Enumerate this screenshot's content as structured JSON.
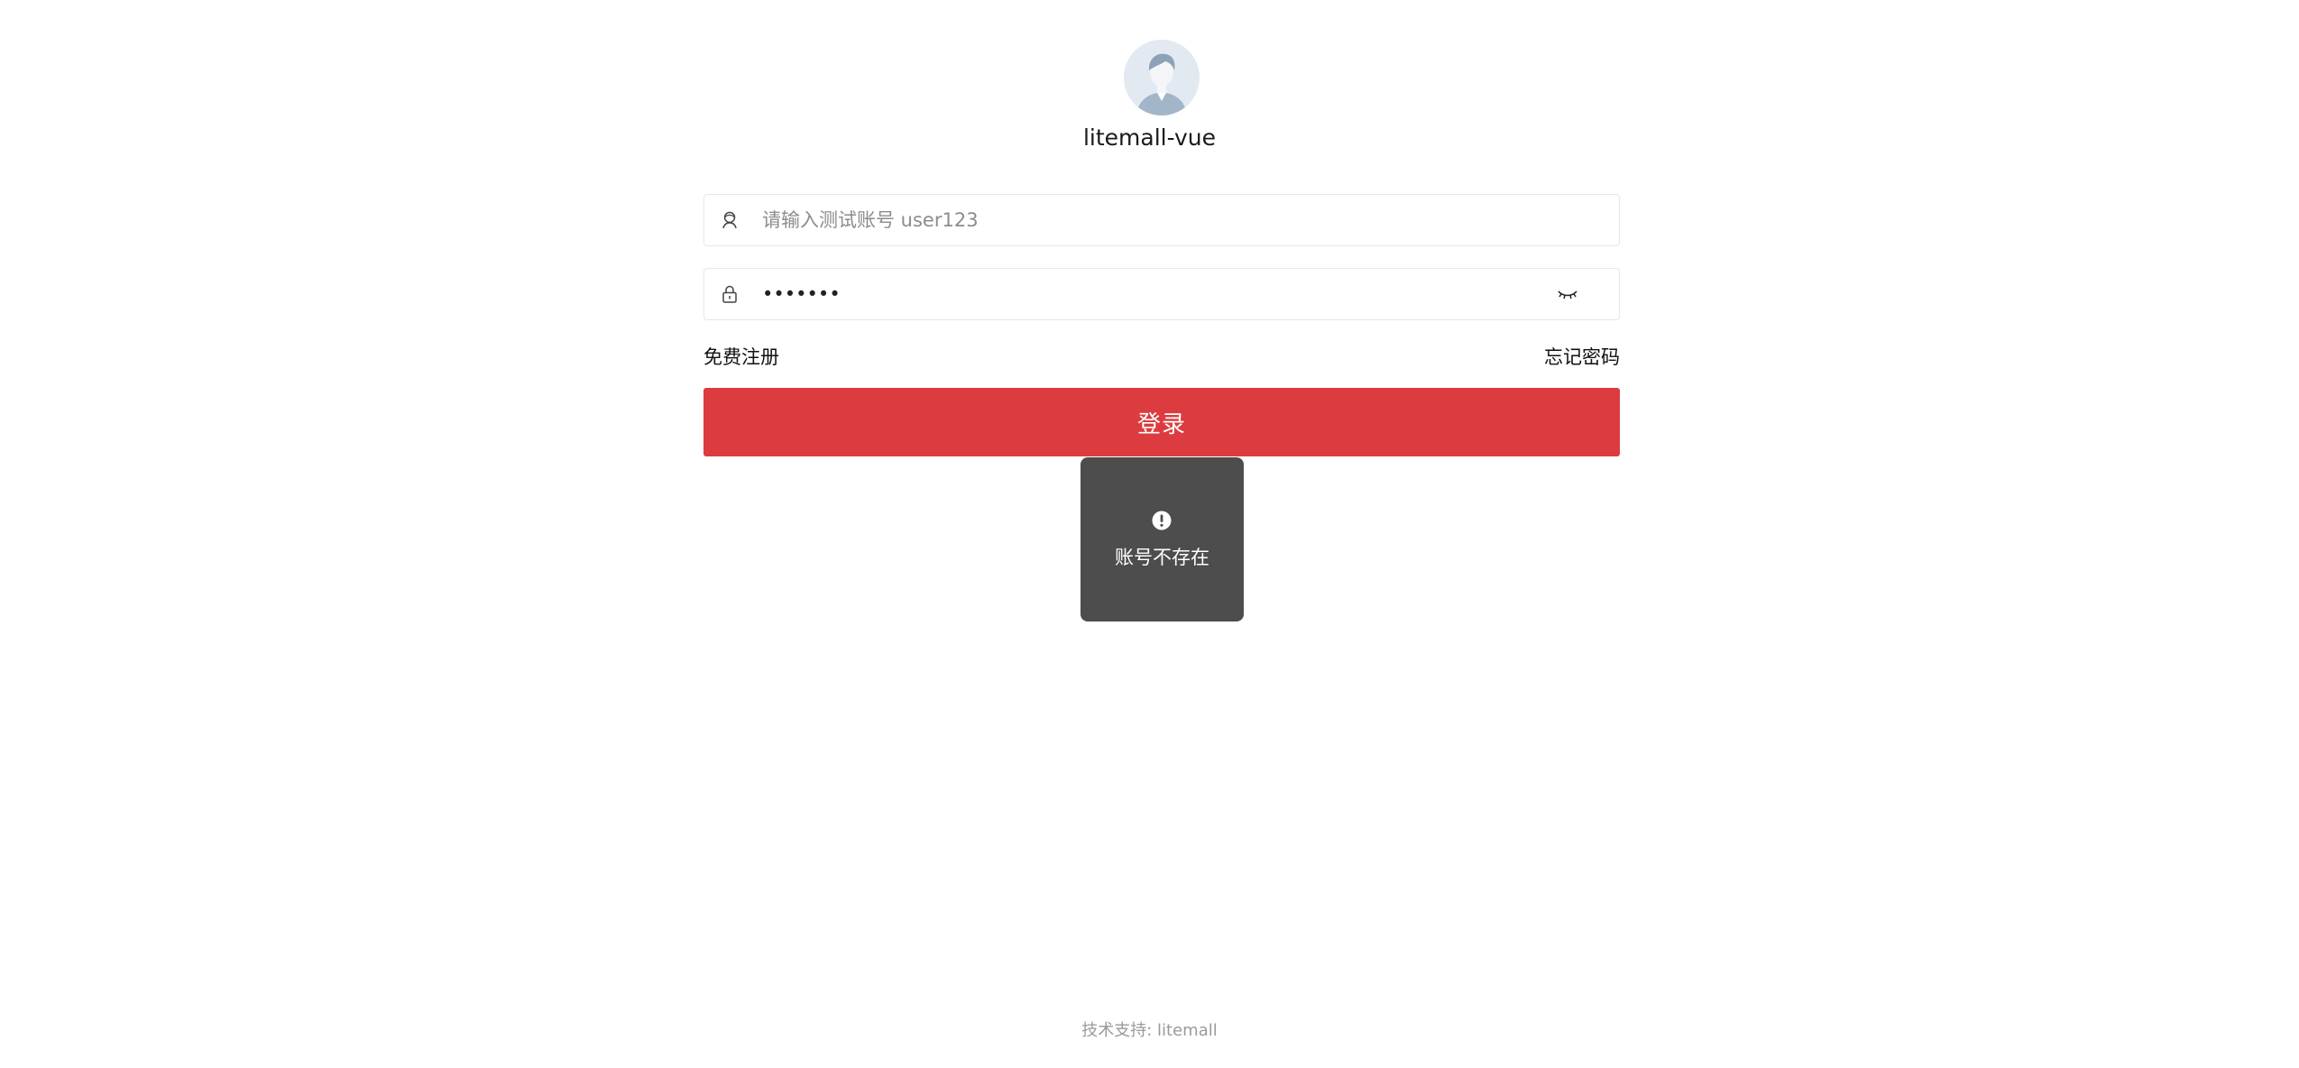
{
  "app": {
    "name": "litemall-vue"
  },
  "login_form": {
    "username": {
      "placeholder": "请输入测试账号 user123",
      "value": "",
      "icon": "user-icon"
    },
    "password": {
      "value": "•••••••",
      "icon": "lock-icon",
      "toggle_icon": "eye-closed-icon"
    },
    "register_link": "免费注册",
    "forgot_link": "忘记密码",
    "submit_label": "登录"
  },
  "toast": {
    "icon": "exclamation-circle-icon",
    "message": "账号不存在"
  },
  "footer": {
    "text": "技术支持: litemall"
  },
  "colors": {
    "primary_button": "#dc3c3f",
    "toast_background": "#4d4d4d",
    "avatar_background": "#e3e9f1"
  }
}
